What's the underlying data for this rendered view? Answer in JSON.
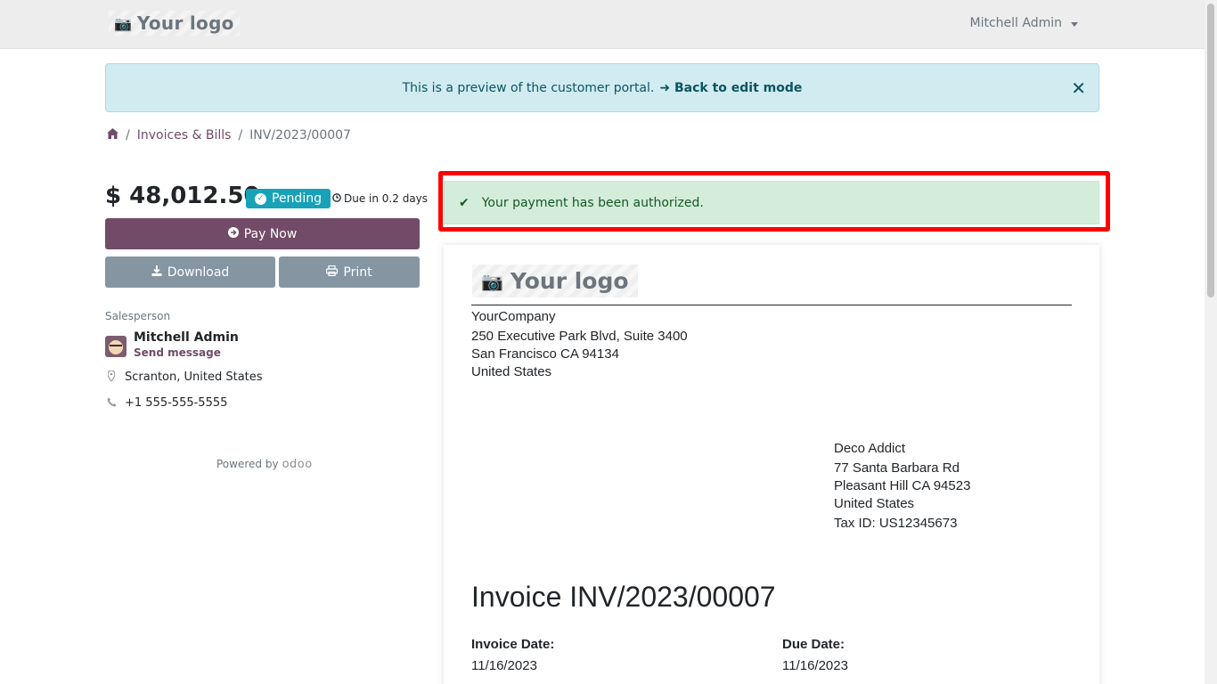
{
  "header": {
    "logo_text": "Your logo",
    "user_name": "Mitchell Admin"
  },
  "preview_alert": {
    "message": "This is a preview of the customer portal.",
    "link_arrow": "➜",
    "link_text": "Back to edit mode",
    "close": "✕"
  },
  "breadcrumb": {
    "separator": "/",
    "items": [
      "Invoices & Bills",
      "INV/2023/00007"
    ]
  },
  "summary": {
    "amount": "$ 48,012.50",
    "status": "Pending",
    "due": "Due in 0.2 days",
    "pay_label": "Pay Now",
    "download_label": "Download",
    "print_label": "Print"
  },
  "salesperson": {
    "label": "Salesperson",
    "name": "Mitchell Admin",
    "send_message": "Send message",
    "location": "Scranton, United States",
    "phone": "+1 555-555-5555"
  },
  "powered": {
    "text": "Powered by",
    "brand": "odoo"
  },
  "success_alert": {
    "message": "Your payment has been authorized."
  },
  "invoice": {
    "logo_text": "Your logo",
    "company": [
      "YourCompany",
      "250 Executive Park Blvd, Suite 3400",
      "San Francisco CA 94134",
      "United States"
    ],
    "customer": [
      "Deco Addict",
      "77 Santa Barbara Rd",
      "Pleasant Hill CA 94523",
      "United States",
      "Tax ID: US12345673"
    ],
    "title": "Invoice INV/2023/00007",
    "invoice_date_label": "Invoice Date:",
    "invoice_date": "11/16/2023",
    "due_date_label": "Due Date:",
    "due_date": "11/16/2023"
  },
  "colors": {
    "brand": "#714b67",
    "secondary_button": "#8595a2",
    "status_pending": "#17a2b8",
    "highlight_border": "#ff0000"
  }
}
